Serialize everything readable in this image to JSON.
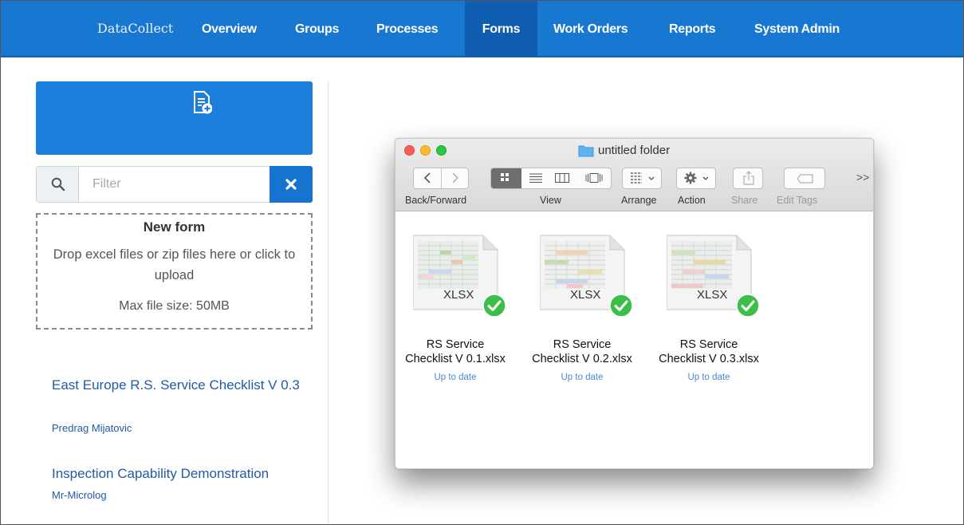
{
  "nav": {
    "brand": "DataCollect",
    "items": [
      {
        "label": "Overview",
        "active": false
      },
      {
        "label": "Groups",
        "active": false
      },
      {
        "label": "Processes",
        "active": false
      },
      {
        "label": "Forms",
        "active": true
      },
      {
        "label": "Work Orders",
        "active": false
      },
      {
        "label": "Reports",
        "active": false
      },
      {
        "label": "System Admin",
        "active": false
      }
    ]
  },
  "sidebar": {
    "form_builder_label": "Use Form Builder to create forms",
    "filter": {
      "placeholder": "Filter",
      "value": ""
    },
    "dropzone": {
      "title": "New form",
      "text": "Drop excel files or zip files here or click to upload",
      "max_size": "Max file size: 50MB"
    },
    "forms": [
      {
        "title": "East Europe R.S. Service Checklist V 0.3",
        "author": "Predrag Mijatovic"
      },
      {
        "title": "Inspection Capability Demonstration",
        "author": "Mr-Microlog"
      }
    ]
  },
  "finder": {
    "title": "untitled folder",
    "toolbar": {
      "back_forward": "Back/Forward",
      "view": "View",
      "arrange": "Arrange",
      "action": "Action",
      "share": "Share",
      "edit_tags": "Edit Tags",
      "more": ">>"
    },
    "files": [
      {
        "type": "XLSX",
        "name_line1": "RS Service",
        "name_line2": "Checklist V 0.1.xlsx",
        "status": "Up to date"
      },
      {
        "type": "XLSX",
        "name_line1": "RS Service",
        "name_line2": "Checklist V 0.2.xlsx",
        "status": "Up to date"
      },
      {
        "type": "XLSX",
        "name_line1": "RS Service",
        "name_line2": "Checklist V 0.3.xlsx",
        "status": "Up to date"
      }
    ]
  },
  "colors": {
    "nav_bg": "#1777d1",
    "nav_active": "#0e5db0",
    "primary_button": "#1b7fdb",
    "link": "#1f5ba8",
    "sync_check": "#3cbf4a"
  }
}
